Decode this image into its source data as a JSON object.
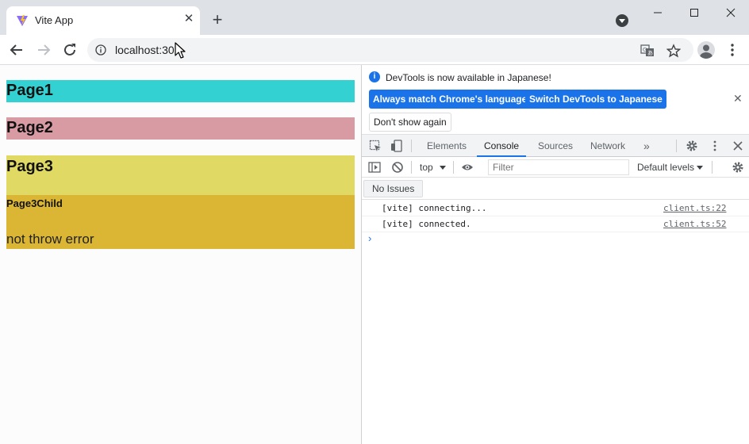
{
  "browser": {
    "tab_title": "Vite App",
    "tab_close": "✕",
    "new_tab": "+",
    "url": "localhost:30",
    "icons": [
      "vite-favicon",
      "close-icon",
      "plus-icon",
      "profile-dropdown-icon",
      "minimize-icon",
      "maximize-icon",
      "window-close-icon",
      "back-arrow-icon",
      "forward-arrow-icon",
      "reload-icon",
      "info-icon",
      "translate-icon",
      "star-icon",
      "avatar-icon",
      "menu-dots-icon",
      "mouse-cursor-icon"
    ]
  },
  "page": {
    "boxes": [
      {
        "label": "Page1",
        "color": "#33d1d1"
      },
      {
        "label": "Page2",
        "color": "#d99ba3"
      },
      {
        "label": "Page3",
        "color": "#e0d963"
      },
      {
        "label": "Page3Child",
        "color": "#dbb635"
      }
    ],
    "child_text": "not throw error"
  },
  "devtools": {
    "infobar": {
      "message": "DevTools is now available in Japanese!",
      "btn_match": "Always match Chrome's language",
      "btn_switch": "Switch DevTools to Japanese",
      "btn_dont_show": "Don't show again",
      "close": "✕"
    },
    "tabs": [
      "Elements",
      "Console",
      "Sources",
      "Network"
    ],
    "active_tab": "Console",
    "more_tabs": "»",
    "console_toolbar": {
      "context": "top",
      "filter_placeholder": "Filter",
      "levels": "Default levels"
    },
    "issues_label": "No Issues",
    "logs": [
      {
        "message": "[vite] connecting...",
        "source": "client.ts:22"
      },
      {
        "message": "[vite] connected.",
        "source": "client.ts:52"
      }
    ],
    "prompt": "›",
    "accent_color": "#1a73e8"
  }
}
